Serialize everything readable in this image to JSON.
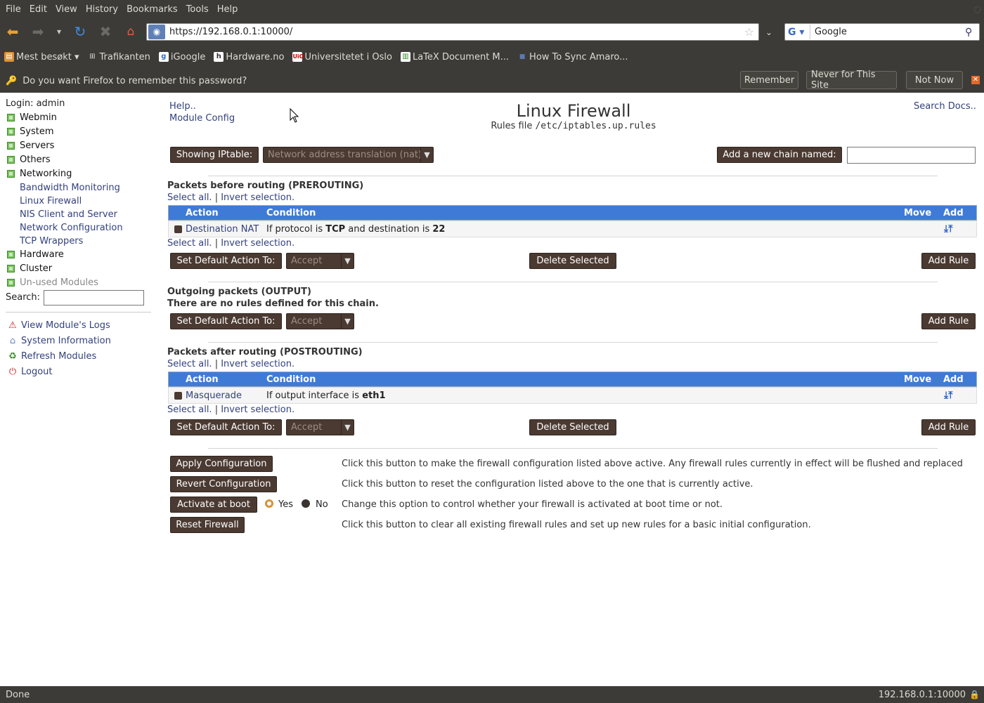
{
  "browser": {
    "menu": [
      "File",
      "Edit",
      "View",
      "History",
      "Bookmarks",
      "Tools",
      "Help"
    ],
    "url": "https://192.168.0.1:10000/",
    "search_value": "Google",
    "bookmarks": [
      "Mest besøkt",
      "Trafikanten",
      "iGoogle",
      "Hardware.no",
      "Universitetet i Oslo",
      "LaTeX Document M...",
      "How To Sync Amaro..."
    ],
    "password_prompt": "Do you want Firefox to remember this password?",
    "prompt_buttons": {
      "remember": "Remember",
      "never": "Never for This Site",
      "not_now": "Not Now"
    },
    "status_left": "Done",
    "status_right": "192.168.0.1:10000"
  },
  "sidebar": {
    "login": "Login: admin",
    "categories": [
      "Webmin",
      "System",
      "Servers",
      "Others",
      "Networking"
    ],
    "networking_items": [
      "Bandwidth Monitoring",
      "Linux Firewall",
      "NIS Client and Server",
      "Network Configuration",
      "TCP Wrappers"
    ],
    "categories_after": [
      "Hardware",
      "Cluster",
      "Un-used Modules"
    ],
    "search_label": "Search:",
    "links": [
      "View Module's Logs",
      "System Information",
      "Refresh Modules",
      "Logout"
    ]
  },
  "page": {
    "help": "Help..",
    "module_config": "Module Config",
    "search_docs": "Search Docs..",
    "title": "Linux Firewall",
    "subtitle_prefix": "Rules file",
    "rules_file": "/etc/iptables.up.rules",
    "showing_label": "Showing IPtable:",
    "table_select": "Network address translation (nat)",
    "add_chain_label": "Add a new chain named:",
    "select_all": "Select all.",
    "invert": "Invert selection.",
    "col_action": "Action",
    "col_condition": "Condition",
    "col_move": "Move",
    "col_add": "Add",
    "set_default": "Set Default Action To:",
    "default_value": "Accept",
    "delete_selected": "Delete Selected",
    "add_rule": "Add Rule"
  },
  "chains": {
    "prerouting": {
      "title": "Packets before routing (PREROUTING)",
      "rule_action": "Destination NAT",
      "cond_a": "If protocol is ",
      "cond_b": "TCP",
      "cond_c": " and destination is ",
      "cond_d": "22"
    },
    "output": {
      "title": "Outgoing packets (OUTPUT)",
      "empty": "There are no rules defined for this chain."
    },
    "postrouting": {
      "title": "Packets after routing (POSTROUTING)",
      "rule_action": "Masquerade",
      "cond_a": "If output interface is ",
      "cond_b": "eth1"
    }
  },
  "actions": {
    "apply": "Apply Configuration",
    "apply_desc": "Click this button to make the firewall configuration listed above active. Any firewall rules currently in effect will be flushed and replaced",
    "revert": "Revert Configuration",
    "revert_desc": "Click this button to reset the configuration listed above to the one that is currently active.",
    "boot": "Activate at boot",
    "yes": "Yes",
    "no": "No",
    "boot_desc": "Change this option to control whether your firewall is activated at boot time or not.",
    "reset": "Reset Firewall",
    "reset_desc": "Click this button to clear all existing firewall rules and set up new rules for a basic initial configuration."
  },
  "colors": {
    "chrome": "#3c3b37",
    "table_header": "#3f7bd6",
    "button": "#4b3a32",
    "link": "#33417e"
  },
  "icons": [
    "key-icon",
    "back-icon",
    "forward-icon",
    "reload-icon",
    "stop-icon",
    "home-icon",
    "bookmark-star-icon",
    "search-icon",
    "warning-icon",
    "system-info-icon",
    "refresh-icon",
    "logout-icon",
    "move-down-icon",
    "move-up-icon",
    "lock-icon"
  ]
}
